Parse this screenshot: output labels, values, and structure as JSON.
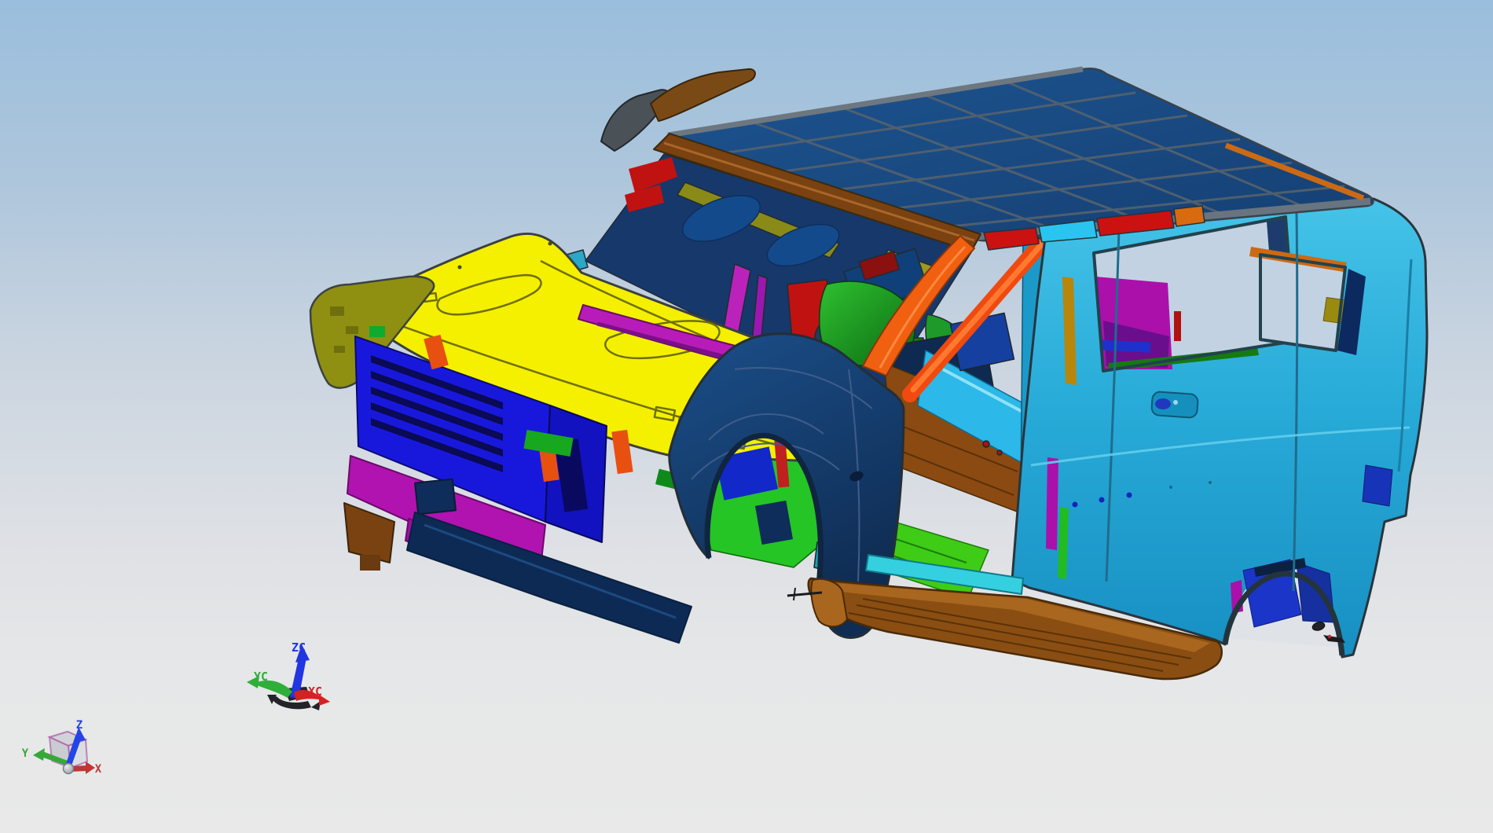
{
  "scene": {
    "type": "3d-cad-viewport",
    "description": "Multi-colored SUV body-in-white CAD model shown in front three-quarter view, floating in a shaded viewport",
    "background_top": "#9abedd",
    "background_mid": "#d6dce3",
    "background_bottom": "#e9e9e9"
  },
  "work_csys": {
    "z_label": "ZC",
    "y_label": "YC",
    "x_label": "XC",
    "z_color": "#2136e0",
    "y_color": "#2fae3a",
    "x_color": "#d42222",
    "base_color": "#242428"
  },
  "abs_csys": {
    "z_label": "Z",
    "y_label": "Y",
    "x_label": "X",
    "z_color": "#2443e8",
    "y_color": "#35a83a",
    "x_color": "#c03636",
    "cube_edge_color": "#b06ab0",
    "cube_face_color": "#cdd1d6",
    "origin_color": "#e8eaec"
  },
  "model_colors": {
    "roof": "#1d5490",
    "roof_deep": "#153f72",
    "roof_grid": "#55626e",
    "drip_rail": "#6d7780",
    "header_brown": "#7a4210",
    "horn_brown": "#7a4a16",
    "horn_gray": "#4a5258",
    "hood": "#f4f000",
    "hood_deep": "#dcd400",
    "hood_line": "#6f6f00",
    "apron_olive": "#8f8f12",
    "cowl_magenta": "#b81cb8",
    "interior_navy": "#16386b",
    "interior_panel": "#134a8c",
    "dark_red": "#8b1010",
    "red_part": "#c11212",
    "seat_green": "#1d9a2a",
    "wheelhouse_green_hi": "#2fc030",
    "wheelhouse_green_lo": "#0b6a12",
    "radiator_blue": "#1818dd",
    "slat_navy": "#0a0a55",
    "member_blue": "#1212c0",
    "bumper_magenta": "#b013b0",
    "magenta2": "#9a10a0",
    "bracket_brown": "#7a4210",
    "chin_navy": "#0d2a55",
    "orange_part": "#e85010",
    "fender_hi": "#1b4f8a",
    "fender_lo": "#0f2c52",
    "splash_green": "#25c525",
    "floor_green": "#3ecc17",
    "floor_brown": "#8a4a12",
    "front_floor_cyan": "#2cb8e8",
    "sill_teal": "#17a0b0",
    "brace_orange": "#f04a10",
    "a_pillar_orange": "#f06010",
    "rail_red": "#cc1111",
    "rail_cyan": "#29c5f0",
    "rail_orange": "#cc6a14",
    "b_pillar_teal": "#1b9aca",
    "mustard": "#b8860b",
    "body_hi": "#45c3e8",
    "body_lo": "#178fc2",
    "cargo_magenta": "#ab10ab",
    "cargo_purple": "#6a0e8e",
    "window_channel_navy": "#0c2a60",
    "glass_sky": "#c3d2e2",
    "arch_sky": "#dfe3e7",
    "arch_box_blue": "#1a35c8",
    "arch_box_blue2": "#16309f",
    "rocker_brown": "#8a4e12",
    "rocker_top": "#a9661e",
    "sill_cyan": "#35d0e0",
    "rear_box_blue": "#1733b8",
    "bolt_blue": "#1226b8",
    "debris_dark": "#232327",
    "edge": "#2e3840"
  }
}
